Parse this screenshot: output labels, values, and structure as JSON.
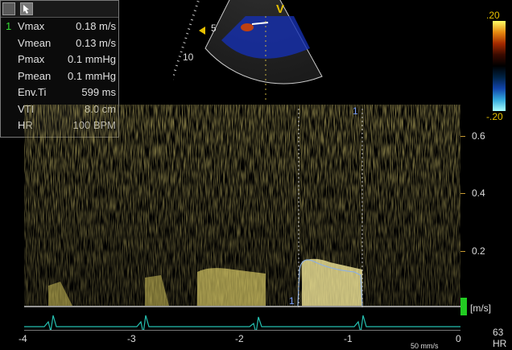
{
  "measurements": {
    "rows": [
      {
        "index": "1",
        "label": "Vmax",
        "value": "0.18 m/s"
      },
      {
        "index": "",
        "label": "Vmean",
        "value": "0.13 m/s"
      },
      {
        "index": "",
        "label": "Pmax",
        "value": "0.1 mmHg"
      },
      {
        "index": "",
        "label": "Pmean",
        "value": "0.1 mmHg"
      },
      {
        "index": "",
        "label": "Env.Ti",
        "value": "599 ms"
      },
      {
        "index": "",
        "label": "VTI",
        "value": "8.0 cm"
      },
      {
        "index": "",
        "label": "HR",
        "value": "100 BPM"
      }
    ]
  },
  "sector": {
    "view_label": "V",
    "depth_labels": [
      "5",
      "10"
    ]
  },
  "color_bar": {
    "top_label": ".20",
    "bottom_label": "-.20",
    "colors": [
      "#ffff66",
      "#e88a10",
      "#a52a00",
      "#3a0a00",
      "#000000",
      "#002244",
      "#1144aa",
      "#33aadd",
      "#aaffff"
    ]
  },
  "velocity_scale": {
    "labels": [
      "0.6",
      "0.4",
      "0.2"
    ],
    "unit": "[m/s]"
  },
  "time_axis": {
    "labels": [
      "-4",
      "-3",
      "-2",
      "-1",
      "0"
    ],
    "sweep_speed": "50 mm/s"
  },
  "calipers": {
    "marker_label": "1"
  },
  "heart_rate": {
    "value": "63",
    "unit": "HR"
  }
}
